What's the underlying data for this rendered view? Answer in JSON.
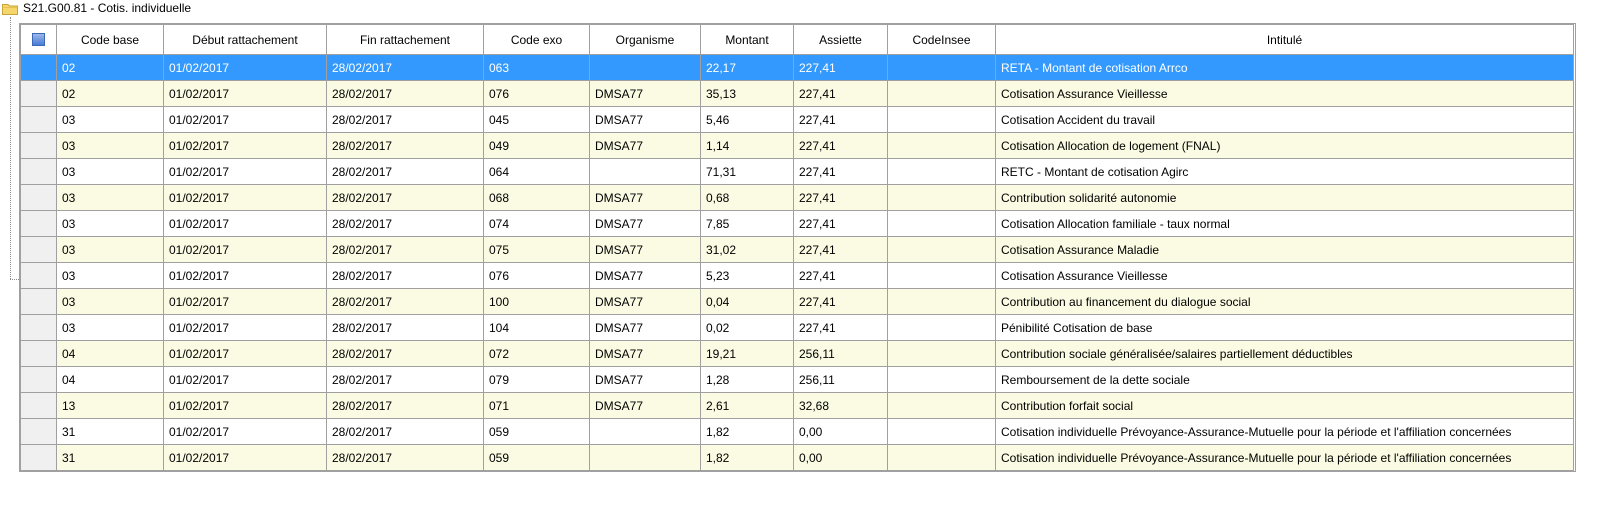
{
  "tree": {
    "node_title": "S21.G00.81 - Cotis. individuelle",
    "icon": "folder-icon"
  },
  "grid": {
    "columns": [
      "Code base",
      "Début rattachement",
      "Fin rattachement",
      "Code exo",
      "Organisme",
      "Montant",
      "Assiette",
      "CodeInsee",
      "Intitulé"
    ],
    "selected_row": 0,
    "rows": [
      [
        "02",
        "01/02/2017",
        "28/02/2017",
        "063",
        "",
        "22,17",
        "227,41",
        "",
        "RETA - Montant de cotisation Arrco"
      ],
      [
        "02",
        "01/02/2017",
        "28/02/2017",
        "076",
        "DMSA77",
        "35,13",
        "227,41",
        "",
        "Cotisation Assurance Vieillesse"
      ],
      [
        "03",
        "01/02/2017",
        "28/02/2017",
        "045",
        "DMSA77",
        "5,46",
        "227,41",
        "",
        "Cotisation Accident du travail"
      ],
      [
        "03",
        "01/02/2017",
        "28/02/2017",
        "049",
        "DMSA77",
        "1,14",
        "227,41",
        "",
        "Cotisation Allocation de logement (FNAL)"
      ],
      [
        "03",
        "01/02/2017",
        "28/02/2017",
        "064",
        "",
        "71,31",
        "227,41",
        "",
        "RETC - Montant de cotisation Agirc"
      ],
      [
        "03",
        "01/02/2017",
        "28/02/2017",
        "068",
        "DMSA77",
        "0,68",
        "227,41",
        "",
        "Contribution solidarité autonomie"
      ],
      [
        "03",
        "01/02/2017",
        "28/02/2017",
        "074",
        "DMSA77",
        "7,85",
        "227,41",
        "",
        "Cotisation Allocation familiale - taux normal"
      ],
      [
        "03",
        "01/02/2017",
        "28/02/2017",
        "075",
        "DMSA77",
        "31,02",
        "227,41",
        "",
        "Cotisation Assurance Maladie"
      ],
      [
        "03",
        "01/02/2017",
        "28/02/2017",
        "076",
        "DMSA77",
        "5,23",
        "227,41",
        "",
        "Cotisation Assurance Vieillesse"
      ],
      [
        "03",
        "01/02/2017",
        "28/02/2017",
        "100",
        "DMSA77",
        "0,04",
        "227,41",
        "",
        "Contribution au financement du dialogue social"
      ],
      [
        "03",
        "01/02/2017",
        "28/02/2017",
        "104",
        "DMSA77",
        "0,02",
        "227,41",
        "",
        "Pénibilité Cotisation de base"
      ],
      [
        "04",
        "01/02/2017",
        "28/02/2017",
        "072",
        "DMSA77",
        "19,21",
        "256,11",
        "",
        "Contribution sociale généralisée/salaires partiellement déductibles"
      ],
      [
        "04",
        "01/02/2017",
        "28/02/2017",
        "079",
        "DMSA77",
        "1,28",
        "256,11",
        "",
        "Remboursement de la dette sociale"
      ],
      [
        "13",
        "01/02/2017",
        "28/02/2017",
        "071",
        "DMSA77",
        "2,61",
        "32,68",
        "",
        "Contribution forfait social"
      ],
      [
        "31",
        "01/02/2017",
        "28/02/2017",
        "059",
        "",
        "1,82",
        "0,00",
        "",
        "Cotisation individuelle Prévoyance-Assurance-Mutuelle pour la période et l'affiliation concernées"
      ],
      [
        "31",
        "01/02/2017",
        "28/02/2017",
        "059",
        "",
        "1,82",
        "0,00",
        "",
        "Cotisation individuelle Prévoyance-Assurance-Mutuelle pour la période et l'affiliation concernées"
      ]
    ]
  },
  "colors": {
    "selected_row_bg": "#3399ff",
    "alt_row_bg": "#fbfbe3",
    "grid_line": "#a0a0a0"
  }
}
